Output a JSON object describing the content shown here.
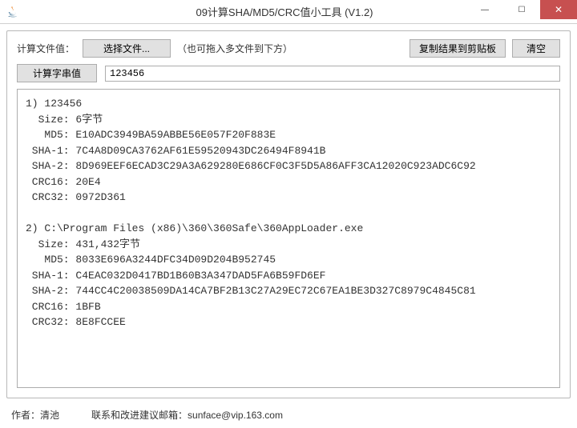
{
  "titlebar": {
    "title": "09计算SHA/MD5/CRC值小工具 (V1.2)"
  },
  "toolbar": {
    "file_label": "计算文件值：",
    "select_file_btn": "选择文件...",
    "drag_hint": "（也可拖入多文件到下方）",
    "copy_btn": "复制结果到剪贴板",
    "clear_btn": "清空",
    "calc_string_btn": "计算字串值",
    "input_value": "123456"
  },
  "results": [
    {
      "index": 1,
      "name": "123456",
      "size": "6字节",
      "md5": "E10ADC3949BA59ABBE56E057F20F883E",
      "sha1": "7C4A8D09CA3762AF61E59520943DC26494F8941B",
      "sha2": "8D969EEF6ECAD3C29A3A629280E686CF0C3F5D5A86AFF3CA12020C923ADC6C92",
      "crc16": "20E4",
      "crc32": "0972D361"
    },
    {
      "index": 2,
      "name": "C:\\Program Files (x86)\\360\\360Safe\\360AppLoader.exe",
      "size": "431,432字节",
      "md5": "8033E696A3244DFC34D09D204B952745",
      "sha1": "C4EAC032D0417BD1B60B3A347DAD5FA6B59FD6EF",
      "sha2": "744CC4C20038509DA14CA7BF2B13C27A29EC72C67EA1BE3D327C8979C4845C81",
      "crc16": "1BFB",
      "crc32": "8E8FCCEE"
    }
  ],
  "footer": {
    "author_label": "作者：清池",
    "contact_label": "联系和改进建议邮箱：",
    "contact_email": "sunface@vip.163.com"
  }
}
